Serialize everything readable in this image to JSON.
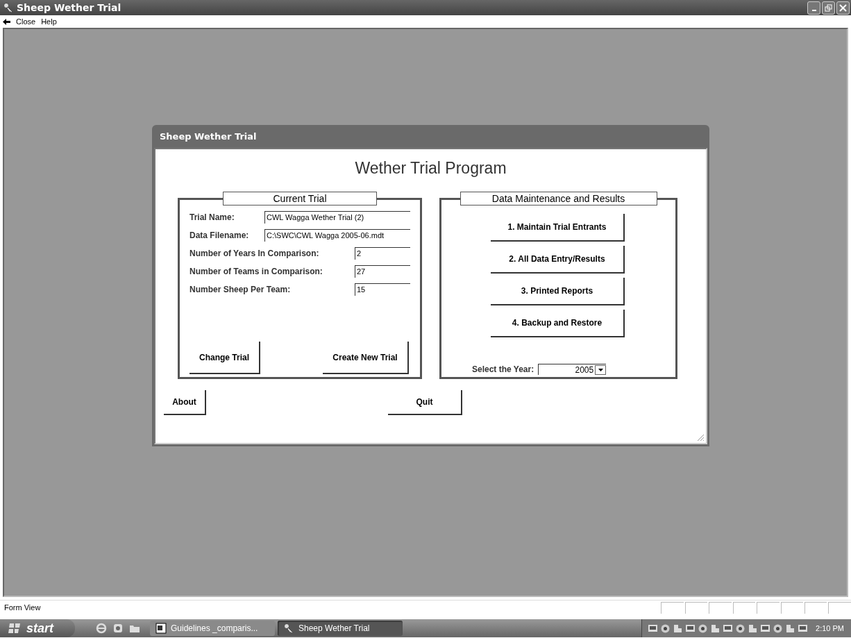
{
  "window": {
    "title": "Sheep Wether Trial"
  },
  "menu": [
    {
      "label": "Close"
    },
    {
      "label": "Help"
    }
  ],
  "form": {
    "title": "Sheep Wether Trial",
    "heading": "Wether Trial Program",
    "current_trial": {
      "title": "Current Trial",
      "fields": [
        {
          "label": "Trial Name:",
          "value": "CWL Wagga Wether Trial (2)",
          "kind": "long"
        },
        {
          "label": "Data Filename:",
          "value": "C:\\SWC\\CWL Wagga 2005-06.mdt",
          "kind": "long"
        },
        {
          "label": "Number of Years In Comparison:",
          "value": "2",
          "kind": "short"
        },
        {
          "label": "Number of Teams in Comparison:",
          "value": "27",
          "kind": "short"
        },
        {
          "label": "Number Sheep Per Team:",
          "value": "15",
          "kind": "short"
        }
      ],
      "buttons": [
        "Change Trial",
        "Create New Trial"
      ]
    },
    "data_maintenance": {
      "title": "Data Maintenance and Results",
      "buttons": [
        "1. Maintain Trial Entrants",
        "2. All Data Entry/Results",
        "3. Printed Reports",
        "4. Backup and Restore"
      ],
      "year_label": "Select the Year:",
      "year_value": "2005"
    },
    "buttons": [
      "About",
      "Quit"
    ]
  },
  "status_bar": {
    "text": "Form View"
  },
  "taskbar": {
    "start": "start",
    "tasks": [
      {
        "label": "Guidelines _comparis...",
        "kind": "document",
        "selected": false
      },
      {
        "label": "Sheep Wether Trial",
        "kind": "app",
        "selected": true
      }
    ],
    "clock": "2:10 PM"
  }
}
